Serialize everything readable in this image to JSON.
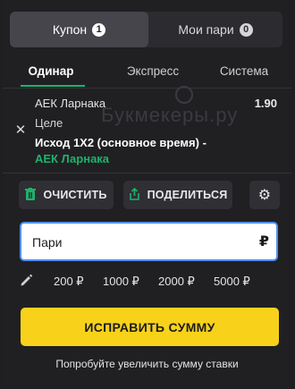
{
  "top_tabs": {
    "coupon": {
      "label": "Купон",
      "count": "1"
    },
    "my_bets": {
      "label": "Мои пари",
      "count": "0"
    }
  },
  "sub_tabs": [
    "Одинар",
    "Экспресс",
    "Система"
  ],
  "bet": {
    "team": "АЕК Ларнака",
    "odds": "1.90",
    "event": "Целе",
    "market": "Исход 1Х2 (основное время) -",
    "selection": "АЕК Ларнака"
  },
  "watermark": "Букмекеры.ру",
  "actions": {
    "clear": "ОЧИСТИТЬ",
    "share": "ПОДЕЛИТЬСЯ"
  },
  "amount": {
    "placeholder": "Пари",
    "value": "",
    "currency": "₽"
  },
  "quick_amounts": [
    "200 ₽",
    "1000 ₽",
    "2000 ₽",
    "5000 ₽"
  ],
  "submit_label": "ИСПРАВИТЬ СУММУ",
  "hint": "Попробуйте увеличить сумму ставки",
  "colors": {
    "accent_green": "#1fb26a",
    "submit_yellow": "#f8d21a",
    "focus_blue": "#4f8ff0"
  }
}
